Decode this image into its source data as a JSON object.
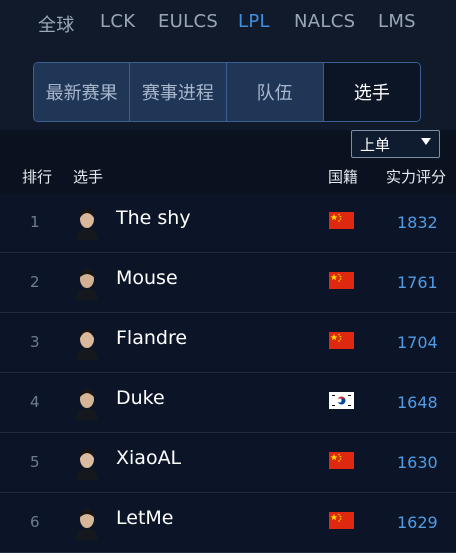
{
  "region_tabs": [
    {
      "label": "全球",
      "active": false
    },
    {
      "label": "LCK",
      "active": false
    },
    {
      "label": "EULCS",
      "active": false
    },
    {
      "label": "LPL",
      "active": true
    },
    {
      "label": "NALCS",
      "active": false
    },
    {
      "label": "LMS",
      "active": false
    }
  ],
  "section_tabs": [
    {
      "label": "最新赛果",
      "active": false
    },
    {
      "label": "赛事进程",
      "active": false
    },
    {
      "label": "队伍",
      "active": false
    },
    {
      "label": "选手",
      "active": true
    }
  ],
  "position_select": {
    "value": "上单"
  },
  "table_header": {
    "rank": "排行",
    "player": "选手",
    "nationality": "国籍",
    "rating": "实力评分"
  },
  "players": [
    {
      "rank": "1",
      "name": "The shy",
      "flag": "china-flag-icon",
      "rating": "1832"
    },
    {
      "rank": "2",
      "name": "Mouse",
      "flag": "china-flag-icon",
      "rating": "1761"
    },
    {
      "rank": "3",
      "name": "Flandre",
      "flag": "china-flag-icon",
      "rating": "1704"
    },
    {
      "rank": "4",
      "name": "Duke",
      "flag": "korea-flag-icon",
      "rating": "1648"
    },
    {
      "rank": "5",
      "name": "XiaoAL",
      "flag": "china-flag-icon",
      "rating": "1630"
    },
    {
      "rank": "6",
      "name": "LetMe",
      "flag": "china-flag-icon",
      "rating": "1629"
    }
  ],
  "colors": {
    "accent": "#3f8fe0",
    "rating": "#4f9be6",
    "background": "#0a1220"
  }
}
